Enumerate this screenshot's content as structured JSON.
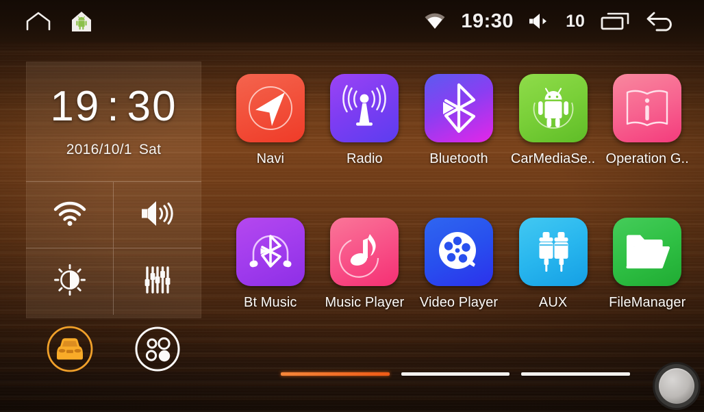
{
  "statusbar": {
    "home_outline_icon": "home-outline-icon",
    "android_home_icon": "android-house-icon",
    "wifi_icon": "wifi-signal-icon",
    "time": "19:30",
    "volume_icon": "volume-speaker-icon",
    "volume_level": "10",
    "recents_icon": "recent-apps-icon",
    "back_icon": "back-arrow-icon"
  },
  "widget": {
    "clock": {
      "hours": "19",
      "separator": ":",
      "minutes": "30"
    },
    "date": "2016/10/1",
    "weekday": "Sat",
    "quick_settings": [
      {
        "name": "wifi",
        "icon": "wifi-icon"
      },
      {
        "name": "volume",
        "icon": "volume-icon"
      },
      {
        "name": "brightness",
        "icon": "brightness-icon"
      },
      {
        "name": "equalizer",
        "icon": "equalizer-icon"
      }
    ],
    "dock": [
      {
        "name": "car-settings",
        "icon": "car-icon",
        "color": "#f5a11e"
      },
      {
        "name": "app-drawer",
        "icon": "app-grid-icon",
        "color": "#ffffff"
      }
    ]
  },
  "apps": [
    {
      "label": "Navi",
      "icon": "navigation-arrow-icon",
      "theme": "g-navi"
    },
    {
      "label": "Radio",
      "icon": "radio-antenna-icon",
      "theme": "g-radio"
    },
    {
      "label": "Bluetooth",
      "icon": "bluetooth-icon",
      "theme": "g-bt"
    },
    {
      "label": "CarMediaSe..",
      "icon": "android-robot-icon",
      "theme": "g-cms"
    },
    {
      "label": "Operation G..",
      "icon": "manual-book-info-icon",
      "theme": "g-opg"
    },
    {
      "label": "Bt Music",
      "icon": "bluetooth-headset-icon",
      "theme": "g-btmus"
    },
    {
      "label": "Music Player",
      "icon": "music-note-icon",
      "theme": "g-mplay"
    },
    {
      "label": "Video Player",
      "icon": "film-reel-icon",
      "theme": "g-vplay"
    },
    {
      "label": "AUX",
      "icon": "rca-plugs-icon",
      "theme": "g-aux"
    },
    {
      "label": "FileManager",
      "icon": "folder-icon",
      "theme": "g-fm"
    }
  ],
  "pager": {
    "pages": 3,
    "active_index": 0,
    "active_color": "#ef5a16",
    "idle_color": "#f4f1ee"
  },
  "knob": {
    "name": "hardware-knob"
  }
}
